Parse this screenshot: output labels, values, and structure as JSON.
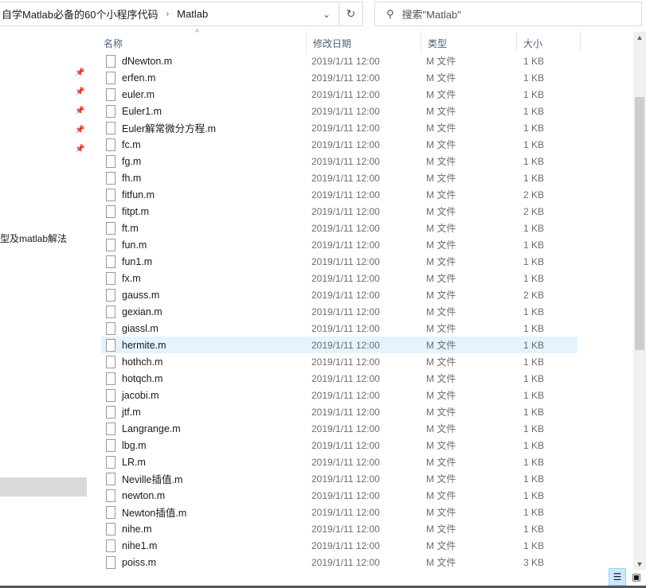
{
  "address": {
    "segments": [
      "自学Matlab必备的60个小程序代码",
      "Matlab"
    ]
  },
  "search": {
    "placeholder": "搜索\"Matlab\""
  },
  "sidebar": {
    "partial_text": "型及matlab解法"
  },
  "columns": [
    "名称",
    "修改日期",
    "类型",
    "大小"
  ],
  "files": [
    [
      "dNewton.m",
      "2019/1/11 12:00",
      "M 文件",
      "1 KB"
    ],
    [
      "erfen.m",
      "2019/1/11 12:00",
      "M 文件",
      "1 KB"
    ],
    [
      "euler.m",
      "2019/1/11 12:00",
      "M 文件",
      "1 KB"
    ],
    [
      "Euler1.m",
      "2019/1/11 12:00",
      "M 文件",
      "1 KB"
    ],
    [
      "Euler解常微分方程.m",
      "2019/1/11 12:00",
      "M 文件",
      "1 KB"
    ],
    [
      "fc.m",
      "2019/1/11 12:00",
      "M 文件",
      "1 KB"
    ],
    [
      "fg.m",
      "2019/1/11 12:00",
      "M 文件",
      "1 KB"
    ],
    [
      "fh.m",
      "2019/1/11 12:00",
      "M 文件",
      "1 KB"
    ],
    [
      "fitfun.m",
      "2019/1/11 12:00",
      "M 文件",
      "2 KB"
    ],
    [
      "fitpt.m",
      "2019/1/11 12:00",
      "M 文件",
      "2 KB"
    ],
    [
      "ft.m",
      "2019/1/11 12:00",
      "M 文件",
      "1 KB"
    ],
    [
      "fun.m",
      "2019/1/11 12:00",
      "M 文件",
      "1 KB"
    ],
    [
      "fun1.m",
      "2019/1/11 12:00",
      "M 文件",
      "1 KB"
    ],
    [
      "fx.m",
      "2019/1/11 12:00",
      "M 文件",
      "1 KB"
    ],
    [
      "gauss.m",
      "2019/1/11 12:00",
      "M 文件",
      "2 KB"
    ],
    [
      "gexian.m",
      "2019/1/11 12:00",
      "M 文件",
      "1 KB"
    ],
    [
      "giassl.m",
      "2019/1/11 12:00",
      "M 文件",
      "1 KB"
    ],
    [
      "hermite.m",
      "2019/1/11 12:00",
      "M 文件",
      "1 KB"
    ],
    [
      "hothch.m",
      "2019/1/11 12:00",
      "M 文件",
      "1 KB"
    ],
    [
      "hotqch.m",
      "2019/1/11 12:00",
      "M 文件",
      "1 KB"
    ],
    [
      "jacobi.m",
      "2019/1/11 12:00",
      "M 文件",
      "1 KB"
    ],
    [
      "jtf.m",
      "2019/1/11 12:00",
      "M 文件",
      "1 KB"
    ],
    [
      "Langrange.m",
      "2019/1/11 12:00",
      "M 文件",
      "1 KB"
    ],
    [
      "lbg.m",
      "2019/1/11 12:00",
      "M 文件",
      "1 KB"
    ],
    [
      "LR.m",
      "2019/1/11 12:00",
      "M 文件",
      "1 KB"
    ],
    [
      "Neville插值.m",
      "2019/1/11 12:00",
      "M 文件",
      "1 KB"
    ],
    [
      "newton.m",
      "2019/1/11 12:00",
      "M 文件",
      "1 KB"
    ],
    [
      "Newton插值.m",
      "2019/1/11 12:00",
      "M 文件",
      "1 KB"
    ],
    [
      "nihe.m",
      "2019/1/11 12:00",
      "M 文件",
      "1 KB"
    ],
    [
      "nihe1.m",
      "2019/1/11 12:00",
      "M 文件",
      "1 KB"
    ],
    [
      "poiss.m",
      "2019/1/11 12:00",
      "M 文件",
      "3 KB"
    ]
  ],
  "hovered_index": 17
}
